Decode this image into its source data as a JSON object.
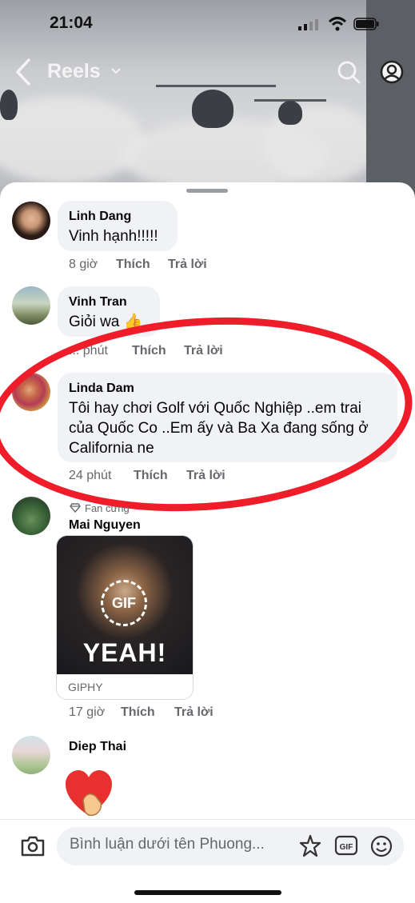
{
  "status_bar": {
    "time": "21:04"
  },
  "top_bar": {
    "title": "Reels"
  },
  "comments": [
    {
      "name": "Linh Dang",
      "text": "Vinh hạnh!!!!!",
      "time": "8 giờ",
      "like": "Thích",
      "reply": "Trả lời"
    },
    {
      "name": "Vinh Tran",
      "text": "Giỏi wa 👍",
      "time": "... phút",
      "like": "Thích",
      "reply": "Trả lời"
    },
    {
      "name": "Linda Dam",
      "text_lines": [
        "Tôi  hay chơi Golf với Quốc Nghiệp ..em trai",
        "của Quốc Co  ..Em ấy và Ba Xa đang sống ở",
        "California  ne"
      ],
      "time": "24 phút",
      "like": "Thích",
      "reply": "Trả lời"
    },
    {
      "badge": "Fan cứng",
      "name": "Mai Nguyen",
      "gif": {
        "badge": "GIF",
        "caption": "YEAH!",
        "source": "GIPHY"
      },
      "time": "17 giờ",
      "like": "Thích",
      "reply": "Trả lời"
    },
    {
      "name": "Diep Thai"
    }
  ],
  "composer": {
    "placeholder": "Bình luận dưới tên Phuong..."
  },
  "colors": {
    "annotation_circle": "#ef1c2a",
    "bubble": "#f0f2f5",
    "meta_text": "#65676b"
  }
}
